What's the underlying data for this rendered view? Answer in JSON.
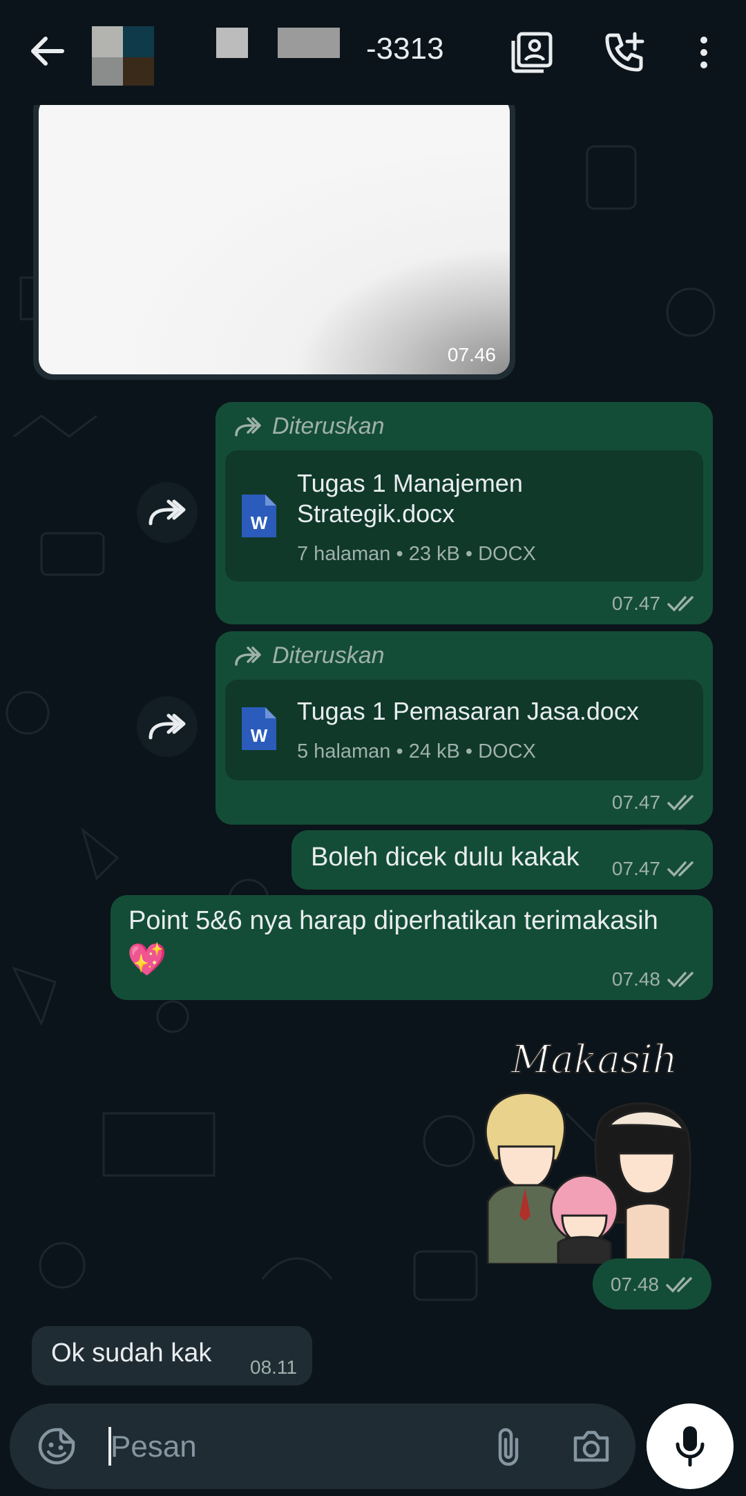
{
  "header": {
    "contact_name": "-3313",
    "icons": [
      "back-arrow-icon",
      "contact-card-icon",
      "add-call-icon",
      "more-vert-icon"
    ]
  },
  "colors": {
    "background": "#0b141a",
    "outgoing_bubble": "#144d37",
    "incoming_bubble": "#1f2c34",
    "doc_card": "#10392a",
    "word_icon": "#2b5cbb"
  },
  "messages": {
    "image": {
      "time": "07.46"
    },
    "doc1": {
      "forwarded_label": "Diteruskan",
      "title_line1": "Tugas 1 Manajemen",
      "title_line2": "Strategik.docx",
      "meta": "7 halaman • 23 kB • DOCX",
      "time": "07.47"
    },
    "doc2": {
      "forwarded_label": "Diteruskan",
      "title_line1": "Tugas 1 Pemasaran Jasa.docx",
      "meta": "5 halaman • 24 kB • DOCX",
      "time": "07.47"
    },
    "text1": {
      "text": "Boleh dicek dulu kakak",
      "time": "07.47"
    },
    "text2": {
      "text": "Point 5&6 nya harap diperhatikan terimakasih",
      "emoji": "💖",
      "time": "07.48"
    },
    "sticker": {
      "caption": "Makasih",
      "time": "07.48"
    },
    "incoming1": {
      "text": "Ok sudah kak",
      "time": "08.11"
    }
  },
  "input": {
    "placeholder": "Pesan",
    "icons": [
      "sticker-icon",
      "attach-icon",
      "camera-icon",
      "mic-icon"
    ]
  }
}
